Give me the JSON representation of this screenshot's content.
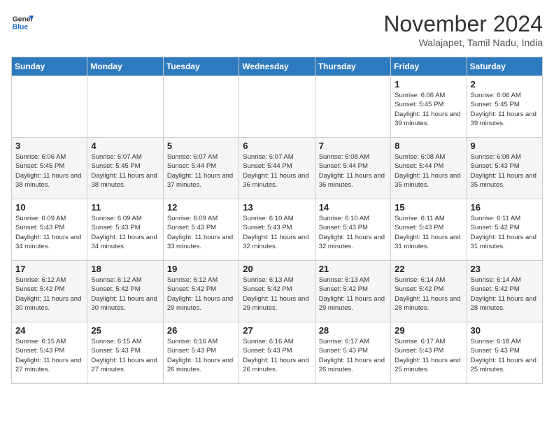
{
  "header": {
    "logo_general": "General",
    "logo_blue": "Blue",
    "month": "November 2024",
    "location": "Walajapet, Tamil Nadu, India"
  },
  "days_of_week": [
    "Sunday",
    "Monday",
    "Tuesday",
    "Wednesday",
    "Thursday",
    "Friday",
    "Saturday"
  ],
  "weeks": [
    [
      {
        "day": "",
        "info": ""
      },
      {
        "day": "",
        "info": ""
      },
      {
        "day": "",
        "info": ""
      },
      {
        "day": "",
        "info": ""
      },
      {
        "day": "",
        "info": ""
      },
      {
        "day": "1",
        "info": "Sunrise: 6:06 AM\nSunset: 5:45 PM\nDaylight: 11 hours and 39 minutes."
      },
      {
        "day": "2",
        "info": "Sunrise: 6:06 AM\nSunset: 5:45 PM\nDaylight: 11 hours and 39 minutes."
      }
    ],
    [
      {
        "day": "3",
        "info": "Sunrise: 6:06 AM\nSunset: 5:45 PM\nDaylight: 11 hours and 38 minutes."
      },
      {
        "day": "4",
        "info": "Sunrise: 6:07 AM\nSunset: 5:45 PM\nDaylight: 11 hours and 38 minutes."
      },
      {
        "day": "5",
        "info": "Sunrise: 6:07 AM\nSunset: 5:44 PM\nDaylight: 11 hours and 37 minutes."
      },
      {
        "day": "6",
        "info": "Sunrise: 6:07 AM\nSunset: 5:44 PM\nDaylight: 11 hours and 36 minutes."
      },
      {
        "day": "7",
        "info": "Sunrise: 6:08 AM\nSunset: 5:44 PM\nDaylight: 11 hours and 36 minutes."
      },
      {
        "day": "8",
        "info": "Sunrise: 6:08 AM\nSunset: 5:44 PM\nDaylight: 11 hours and 35 minutes."
      },
      {
        "day": "9",
        "info": "Sunrise: 6:08 AM\nSunset: 5:43 PM\nDaylight: 11 hours and 35 minutes."
      }
    ],
    [
      {
        "day": "10",
        "info": "Sunrise: 6:09 AM\nSunset: 5:43 PM\nDaylight: 11 hours and 34 minutes."
      },
      {
        "day": "11",
        "info": "Sunrise: 6:09 AM\nSunset: 5:43 PM\nDaylight: 11 hours and 34 minutes."
      },
      {
        "day": "12",
        "info": "Sunrise: 6:09 AM\nSunset: 5:43 PM\nDaylight: 11 hours and 33 minutes."
      },
      {
        "day": "13",
        "info": "Sunrise: 6:10 AM\nSunset: 5:43 PM\nDaylight: 11 hours and 32 minutes."
      },
      {
        "day": "14",
        "info": "Sunrise: 6:10 AM\nSunset: 5:43 PM\nDaylight: 11 hours and 32 minutes."
      },
      {
        "day": "15",
        "info": "Sunrise: 6:11 AM\nSunset: 5:43 PM\nDaylight: 11 hours and 31 minutes."
      },
      {
        "day": "16",
        "info": "Sunrise: 6:11 AM\nSunset: 5:42 PM\nDaylight: 11 hours and 31 minutes."
      }
    ],
    [
      {
        "day": "17",
        "info": "Sunrise: 6:12 AM\nSunset: 5:42 PM\nDaylight: 11 hours and 30 minutes."
      },
      {
        "day": "18",
        "info": "Sunrise: 6:12 AM\nSunset: 5:42 PM\nDaylight: 11 hours and 30 minutes."
      },
      {
        "day": "19",
        "info": "Sunrise: 6:12 AM\nSunset: 5:42 PM\nDaylight: 11 hours and 29 minutes."
      },
      {
        "day": "20",
        "info": "Sunrise: 6:13 AM\nSunset: 5:42 PM\nDaylight: 11 hours and 29 minutes."
      },
      {
        "day": "21",
        "info": "Sunrise: 6:13 AM\nSunset: 5:42 PM\nDaylight: 11 hours and 29 minutes."
      },
      {
        "day": "22",
        "info": "Sunrise: 6:14 AM\nSunset: 5:42 PM\nDaylight: 11 hours and 28 minutes."
      },
      {
        "day": "23",
        "info": "Sunrise: 6:14 AM\nSunset: 5:42 PM\nDaylight: 11 hours and 28 minutes."
      }
    ],
    [
      {
        "day": "24",
        "info": "Sunrise: 6:15 AM\nSunset: 5:43 PM\nDaylight: 11 hours and 27 minutes."
      },
      {
        "day": "25",
        "info": "Sunrise: 6:15 AM\nSunset: 5:43 PM\nDaylight: 11 hours and 27 minutes."
      },
      {
        "day": "26",
        "info": "Sunrise: 6:16 AM\nSunset: 5:43 PM\nDaylight: 11 hours and 26 minutes."
      },
      {
        "day": "27",
        "info": "Sunrise: 6:16 AM\nSunset: 5:43 PM\nDaylight: 11 hours and 26 minutes."
      },
      {
        "day": "28",
        "info": "Sunrise: 6:17 AM\nSunset: 5:43 PM\nDaylight: 11 hours and 26 minutes."
      },
      {
        "day": "29",
        "info": "Sunrise: 6:17 AM\nSunset: 5:43 PM\nDaylight: 11 hours and 25 minutes."
      },
      {
        "day": "30",
        "info": "Sunrise: 6:18 AM\nSunset: 5:43 PM\nDaylight: 11 hours and 25 minutes."
      }
    ]
  ]
}
